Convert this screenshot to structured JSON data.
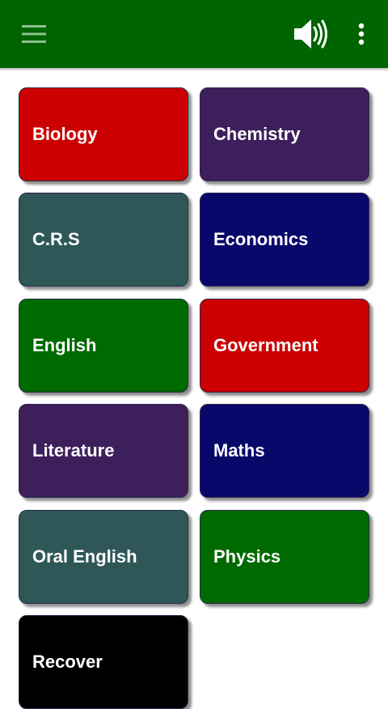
{
  "appbar": {
    "background": "#006400",
    "menu_icon": "hamburger-menu-icon",
    "sound_icon": "volume-up-icon",
    "more_icon": "more-vert-icon"
  },
  "subjects": [
    {
      "label": "Biology",
      "color": "#CC0000"
    },
    {
      "label": "Chemistry",
      "color": "#3D1F5B"
    },
    {
      "label": "C.R.S",
      "color": "#2F5757"
    },
    {
      "label": "Economics",
      "color": "#08086B"
    },
    {
      "label": "English",
      "color": "#006A00"
    },
    {
      "label": "Government",
      "color": "#CC0000"
    },
    {
      "label": "Literature",
      "color": "#3D1F5B"
    },
    {
      "label": "Maths",
      "color": "#08086B"
    },
    {
      "label": "Oral English",
      "color": "#2F5757"
    },
    {
      "label": "Physics",
      "color": "#006A00"
    },
    {
      "label": "Recover",
      "color": "#000000"
    }
  ]
}
